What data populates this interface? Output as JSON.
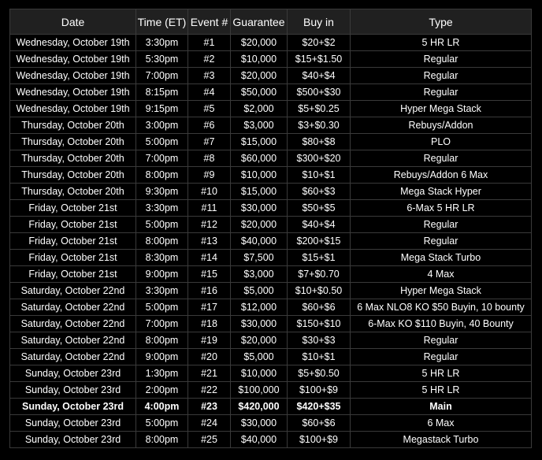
{
  "table": {
    "headers": [
      "Date",
      "Time (ET)",
      "Event #",
      "Guarantee",
      "Buy in",
      "Type"
    ],
    "rows": [
      {
        "cells": [
          "Wednesday, October 19th",
          "3:30pm",
          "#1",
          "$20,000",
          "$20+$2",
          "5 HR LR"
        ]
      },
      {
        "cells": [
          "Wednesday, October 19th",
          "5:30pm",
          "#2",
          "$10,000",
          "$15+$1.50",
          "Regular"
        ]
      },
      {
        "cells": [
          "Wednesday, October 19th",
          "7:00pm",
          "#3",
          "$20,000",
          "$40+$4",
          "Regular"
        ]
      },
      {
        "cells": [
          "Wednesday, October 19th",
          "8:15pm",
          "#4",
          "$50,000",
          "$500+$30",
          "Regular"
        ]
      },
      {
        "cells": [
          "Wednesday, October 19th",
          "9:15pm",
          "#5",
          "$2,000",
          "$5+$0.25",
          "Hyper Mega Stack"
        ]
      },
      {
        "cells": [
          "Thursday, October 20th",
          "3:00pm",
          "#6",
          "$3,000",
          "$3+$0.30",
          "Rebuys/Addon"
        ]
      },
      {
        "cells": [
          "Thursday, October 20th",
          "5:00pm",
          "#7",
          "$15,000",
          "$80+$8",
          "PLO"
        ]
      },
      {
        "cells": [
          "Thursday, October 20th",
          "7:00pm",
          "#8",
          "$60,000",
          "$300+$20",
          "Regular"
        ]
      },
      {
        "cells": [
          "Thursday, October 20th",
          "8:00pm",
          "#9",
          "$10,000",
          "$10+$1",
          "Rebuys/Addon 6 Max"
        ]
      },
      {
        "cells": [
          "Thursday, October 20th",
          "9:30pm",
          "#10",
          "$15,000",
          "$60+$3",
          "Mega Stack Hyper"
        ]
      },
      {
        "cells": [
          "Friday, October 21st",
          "3:30pm",
          "#11",
          "$30,000",
          "$50+$5",
          "6-Max 5 HR LR"
        ]
      },
      {
        "cells": [
          "Friday, October 21st",
          "5:00pm",
          "#12",
          "$20,000",
          "$40+$4",
          "Regular"
        ]
      },
      {
        "cells": [
          "Friday, October 21st",
          "8:00pm",
          "#13",
          "$40,000",
          "$200+$15",
          "Regular"
        ]
      },
      {
        "cells": [
          "Friday, October 21st",
          "8:30pm",
          "#14",
          "$7,500",
          "$15+$1",
          "Mega Stack Turbo"
        ]
      },
      {
        "cells": [
          "Friday, October 21st",
          "9:00pm",
          "#15",
          "$3,000",
          "$7+$0.70",
          "4 Max"
        ]
      },
      {
        "cells": [
          "Saturday, October 22nd",
          "3:30pm",
          "#16",
          "$5,000",
          "$10+$0.50",
          "Hyper Mega Stack"
        ]
      },
      {
        "cells": [
          "Saturday, October 22nd",
          "5:00pm",
          "#17",
          "$12,000",
          "$60+$6",
          "6 Max NLO8 KO $50 Buyin, 10 bounty"
        ]
      },
      {
        "cells": [
          "Saturday, October 22nd",
          "7:00pm",
          "#18",
          "$30,000",
          "$150+$10",
          "6-Max KO $110 Buyin, 40 Bounty"
        ]
      },
      {
        "cells": [
          "Saturday, October 22nd",
          "8:00pm",
          "#19",
          "$20,000",
          "$30+$3",
          "Regular"
        ]
      },
      {
        "cells": [
          "Saturday, October 22nd",
          "9:00pm",
          "#20",
          "$5,000",
          "$10+$1",
          "Regular"
        ]
      },
      {
        "cells": [
          "Sunday, October 23rd",
          "1:30pm",
          "#21",
          "$10,000",
          "$5+$0.50",
          "5 HR LR"
        ]
      },
      {
        "cells": [
          "Sunday, October 23rd",
          "2:00pm",
          "#22",
          "$100,000",
          "$100+$9",
          "5 HR LR"
        ]
      },
      {
        "cells": [
          "Sunday, October 23rd",
          "4:00pm",
          "#23",
          "$420,000",
          "$420+$35",
          "Main"
        ],
        "bold": true
      },
      {
        "cells": [
          "Sunday, October 23rd",
          "5:00pm",
          "#24",
          "$30,000",
          "$60+$6",
          "6 Max"
        ]
      },
      {
        "cells": [
          "Sunday, October 23rd",
          "8:00pm",
          "#25",
          "$40,000",
          "$100+$9",
          "Megastack Turbo"
        ]
      }
    ]
  }
}
